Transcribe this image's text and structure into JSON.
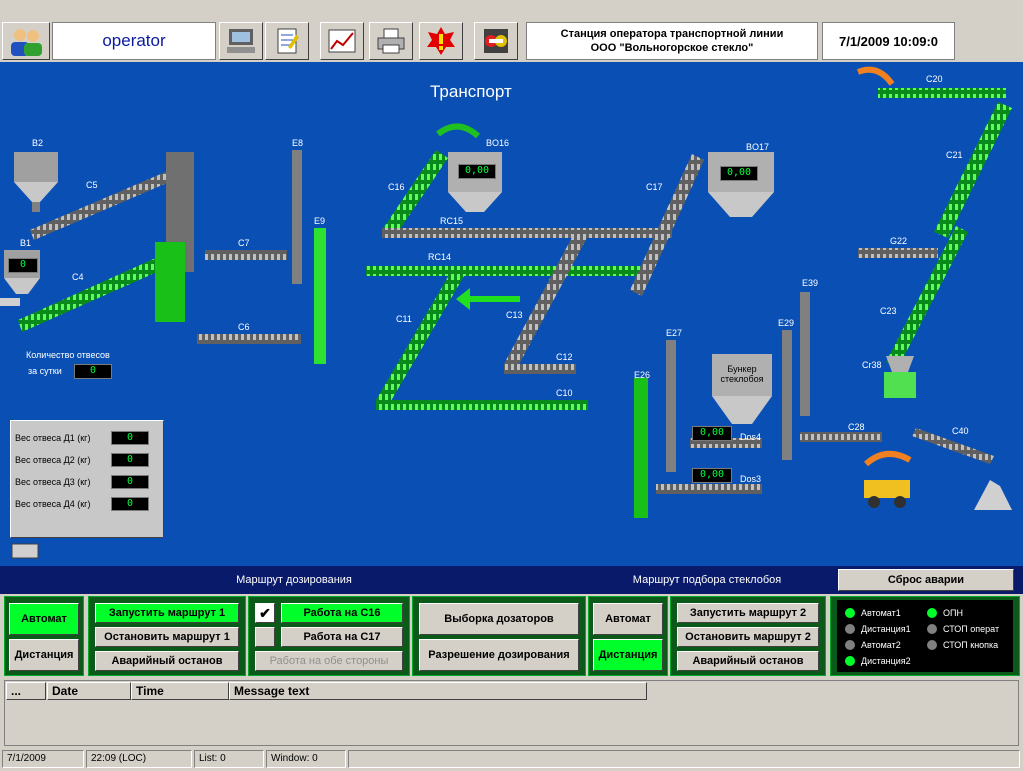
{
  "topbar": {
    "user": "operator",
    "station_line1": "Станция оператора транспортной линии",
    "station_line2": "ООО \"Вольногорское стекло\"",
    "clock": "7/1/2009 10:09:0"
  },
  "main": {
    "title": "Транспорт",
    "labels": {
      "B2": "B2",
      "B1": "B1",
      "C5": "C5",
      "C4": "C4",
      "C7": "C7",
      "C6": "C6",
      "E8": "E8",
      "E9": "E9",
      "C16": "C16",
      "BO16": "BO16",
      "RC15": "RC15",
      "RC14": "RC14",
      "C11": "C11",
      "C13": "C13",
      "C12": "C12",
      "C10": "C10",
      "C17": "C17",
      "BO17": "BO17",
      "E27": "E27",
      "E26": "E26",
      "E29": "E29",
      "E39": "E39",
      "Dos4": "Dos4",
      "Dos3": "Dos3",
      "C28": "C28",
      "Cr38": "Cr38",
      "C40": "C40",
      "C23": "C23",
      "G22": "G22",
      "C21": "C21",
      "C20": "C20"
    },
    "bunker_line1": "Бункер",
    "bunker_line2": "стеклобоя",
    "bo16_value": "0,00",
    "bo17_value": "0,00",
    "b1_value": "0",
    "dos4_value": "0,00",
    "dos3_value": "0,00",
    "count_label1": "Количество отвесов",
    "count_label2": "за сутки",
    "count_value": "0",
    "weights": [
      {
        "label": "Вес отвеса Д1 (кг)",
        "value": "0"
      },
      {
        "label": "Вес отвеса Д2 (кг)",
        "value": "0"
      },
      {
        "label": "Вес отвеса Д3 (кг)",
        "value": "0"
      },
      {
        "label": "Вес отвеса Д4 (кг)",
        "value": "0"
      }
    ]
  },
  "controls": {
    "route1_header": "Маршрут дозирования",
    "route2_header": "Маршрут подбора стеклобоя",
    "reset_alarm": "Сброс аварии",
    "mode1": {
      "auto": "Автомат",
      "remote": "Дистанция"
    },
    "route1": {
      "start": "Запустить маршрут 1",
      "stop": "Остановить маршрут 1",
      "emergency": "Аварийный останов"
    },
    "work": {
      "c16": "Работа на C16",
      "c17": "Работа на C17",
      "both": "Работа на обе стороны",
      "c16_checked": true
    },
    "dosing": {
      "select": "Выборка дозаторов",
      "permit": "Разрешение дозирования"
    },
    "mode2": {
      "auto": "Автомат",
      "remote": "Дистанция"
    },
    "route2": {
      "start": "Запустить маршрут 2",
      "stop": "Остановить маршрут 2",
      "emergency": "Аварийный останов"
    },
    "status": [
      {
        "label": "Автомат1",
        "color": "#00ff2a"
      },
      {
        "label": "Дистанция1",
        "color": "#808080"
      },
      {
        "label": "Автомат2",
        "color": "#808080"
      },
      {
        "label": "Дистанция2",
        "color": "#00ff2a"
      },
      {
        "label": "ОПН",
        "color": "#00ff2a"
      },
      {
        "label": "СТОП операт",
        "color": "#808080"
      },
      {
        "label": "СТОП кнопка",
        "color": "#808080"
      }
    ]
  },
  "messages": {
    "columns": [
      "...",
      "Date",
      "Time",
      "Message text"
    ]
  },
  "statusbar": {
    "date": "7/1/2009",
    "time": "22:09 (LOC)",
    "list": "List: 0",
    "window": "Window: 0"
  }
}
